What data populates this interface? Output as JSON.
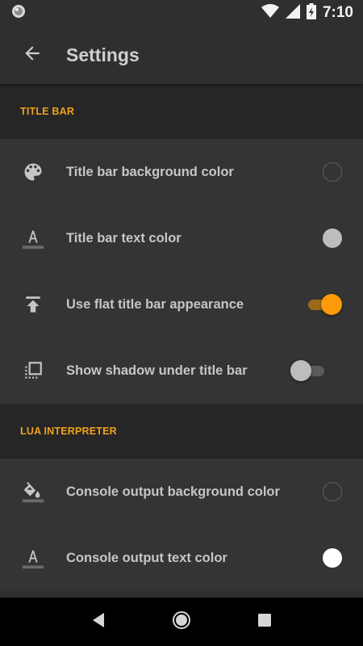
{
  "status_bar": {
    "time": "7:10",
    "icons": [
      "app-notification-icon",
      "wifi-icon",
      "cell-signal-icon",
      "battery-icon"
    ]
  },
  "app_bar": {
    "title": "Settings",
    "back_icon": "arrow-back-icon"
  },
  "sections": [
    {
      "header": "TITLE BAR",
      "items": [
        {
          "label": "Title bar background color",
          "icon": "palette-icon",
          "control": "color",
          "value": "empty"
        },
        {
          "label": "Title bar text color",
          "icon": "text-color-icon",
          "control": "color",
          "value": "#bdbdbd"
        },
        {
          "label": "Use flat title bar appearance",
          "icon": "upload-flat-icon",
          "control": "switch",
          "value": true
        },
        {
          "label": "Show shadow under title bar",
          "icon": "select-square-icon",
          "control": "switch",
          "value": false
        }
      ]
    },
    {
      "header": "LUA INTERPRETER",
      "items": [
        {
          "label": "Console output background color",
          "icon": "fill-bucket-icon",
          "control": "color",
          "value": "empty"
        },
        {
          "label": "Console output text color",
          "icon": "text-color-icon",
          "control": "color",
          "value": "#ffffff"
        }
      ]
    }
  ],
  "colors": {
    "accent": "#ff9a0b",
    "section_header": "#f0a11d",
    "background": "#343434",
    "header_background": "#262626"
  },
  "nav_bar": {
    "icons": [
      "nav-back-icon",
      "nav-home-icon",
      "nav-recents-icon"
    ]
  }
}
